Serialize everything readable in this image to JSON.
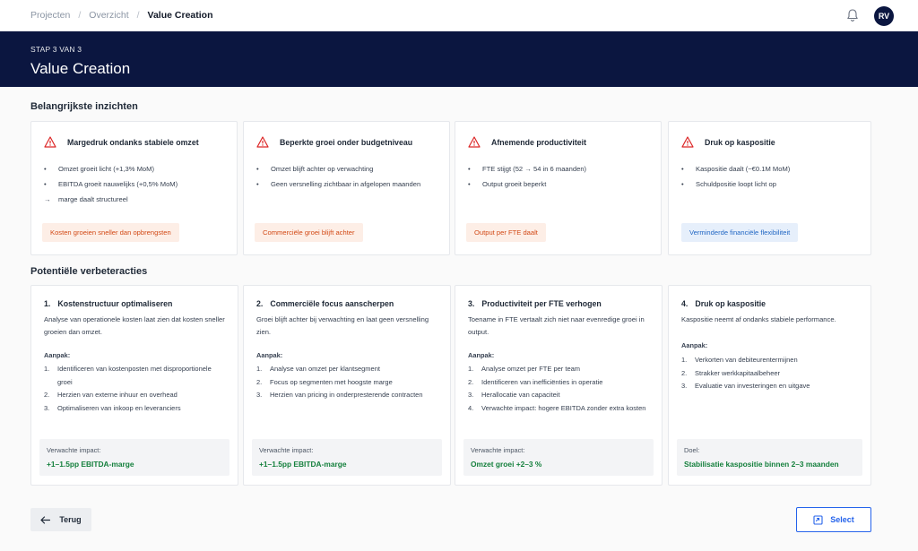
{
  "breadcrumb": [
    "Projecten",
    "Overzicht",
    "Value Creation"
  ],
  "user": {
    "initials": "RV"
  },
  "hero": {
    "step": "STAP 3 VAN 3",
    "title": "Value Creation"
  },
  "insights_title": "Belangrijkste inzichten",
  "insights": [
    {
      "title": "Margedruk ondanks stabiele omzet",
      "bullets": [
        {
          "mark": "•",
          "text": "Omzet groeit licht (+1,3% MoM)"
        },
        {
          "mark": "•",
          "text": "EBITDA groeit nauwelijks (+0,5% MoM)"
        },
        {
          "mark": "→",
          "text": "marge daalt structureel"
        }
      ],
      "tag": "Kosten groeien sneller dan opbrengsten",
      "tag_style": "warn"
    },
    {
      "title": "Beperkte groei onder budgetniveau",
      "bullets": [
        {
          "mark": "•",
          "text": "Omzet blijft achter op verwachting"
        },
        {
          "mark": "•",
          "text": "Geen versnelling zichtbaar in afgelopen maanden"
        }
      ],
      "tag": "Commerciële groei blijft achter",
      "tag_style": "warn"
    },
    {
      "title": "Afnemende productiviteit",
      "bullets": [
        {
          "mark": "•",
          "text": "FTE stijgt (52 → 54 in 6 maanden)"
        },
        {
          "mark": "•",
          "text": "Output groeit beperkt"
        }
      ],
      "tag": "Output per FTE daalt",
      "tag_style": "warn"
    },
    {
      "title": "Druk op kaspositie",
      "bullets": [
        {
          "mark": "•",
          "text": "Kaspositie daalt (−€0.1M MoM)"
        },
        {
          "mark": "•",
          "text": "Schuldpositie loopt licht op"
        }
      ],
      "tag": "Verminderde financiële flexibiliteit",
      "tag_style": "info"
    }
  ],
  "actions_title": "Potentiële verbeteracties",
  "actions": [
    {
      "num": "1.",
      "title": "Kostenstructuur optimaliseren",
      "desc": "Analyse van operationele kosten laat zien dat kosten sneller groeien dan omzet.",
      "approach_label": "Aanpak:",
      "steps": [
        {
          "n": "1.",
          "text": "Identificeren van kostenposten met disproportionele groei"
        },
        {
          "n": "2.",
          "text": "Herzien van externe inhuur en overhead"
        },
        {
          "n": "3.",
          "text": "Optimaliseren van inkoop en leveranciers"
        }
      ],
      "impact_label": "Verwachte impact:",
      "impact_value": "+1–1.5pp EBITDA-marge"
    },
    {
      "num": "2.",
      "title": "Commerciële focus aanscherpen",
      "desc": "Groei blijft achter bij verwachting en laat geen versnelling zien.",
      "approach_label": "Aanpak:",
      "steps": [
        {
          "n": "1.",
          "text": "Analyse van omzet per klantsegment"
        },
        {
          "n": "2.",
          "text": "Focus op segmenten met hoogste marge"
        },
        {
          "n": "3.",
          "text": "Herzien van pricing in onderpresterende contracten"
        }
      ],
      "impact_label": "Verwachte impact:",
      "impact_value": "+1–1.5pp EBITDA-marge"
    },
    {
      "num": "3.",
      "title": "Productiviteit per FTE verhogen",
      "desc": "Toename in FTE vertaalt zich niet naar evenredige groei in output.",
      "approach_label": "Aanpak:",
      "steps": [
        {
          "n": "1.",
          "text": "Analyse omzet per FTE per team"
        },
        {
          "n": "2.",
          "text": "Identificeren van inefficiënties in operatie"
        },
        {
          "n": "3.",
          "text": "Herallocatie van capaciteit"
        },
        {
          "n": "4.",
          "text": "Verwachte impact: hogere EBITDA zonder extra kosten"
        }
      ],
      "impact_label": "Verwachte impact:",
      "impact_value": "Omzet groei +2–3 %"
    },
    {
      "num": "4.",
      "title": "Druk op kaspositie",
      "desc": "Kaspositie neemt af ondanks stabiele performance.",
      "approach_label": "Aanpak:",
      "steps": [
        {
          "n": "1.",
          "text": "Verkorten van debiteurentermijnen"
        },
        {
          "n": "2.",
          "text": "Strakker werkkapitaalbeheer"
        },
        {
          "n": "3.",
          "text": "Evaluatie van investeringen en uitgave"
        }
      ],
      "impact_label": "Doel:",
      "impact_value": "Stabilisatie kaspositie binnen 2–3 maanden"
    }
  ],
  "buttons": {
    "back": "Terug",
    "select": "Select"
  },
  "colors": {
    "navy": "#0b1640",
    "warning": "#d24a17",
    "success": "#15803d",
    "primary": "#2563eb"
  },
  "icons": {
    "bell": "bell-icon",
    "warning": "warning-triangle-icon",
    "back": "arrow-left-icon",
    "select": "select-icon"
  }
}
